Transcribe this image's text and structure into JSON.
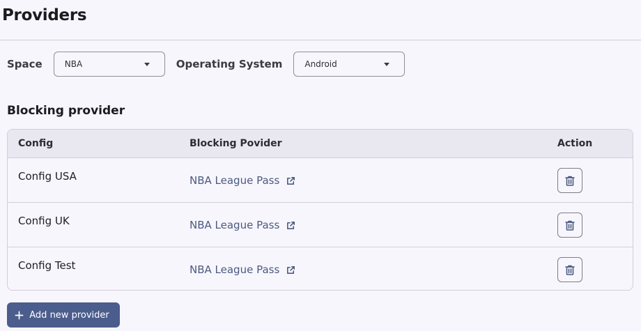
{
  "page": {
    "title": "Providers"
  },
  "filters": {
    "space": {
      "label": "Space",
      "value": "NBA"
    },
    "os": {
      "label": "Operating System",
      "value": "Android"
    }
  },
  "section": {
    "title": "Blocking provider"
  },
  "table": {
    "headers": {
      "config": "Config",
      "provider": "Blocking Povider",
      "action": "Action"
    },
    "rows": [
      {
        "config": "Config USA",
        "provider": "NBA League Pass"
      },
      {
        "config": "Config UK",
        "provider": "NBA League Pass"
      },
      {
        "config": "Config Test",
        "provider": "NBA League Pass"
      }
    ]
  },
  "actions": {
    "add_label": "Add new provider"
  },
  "colors": {
    "accent": "#4b5d8c",
    "link": "#4a5a80",
    "background": "#f8f6fd"
  },
  "icons": {
    "external": "external-link-icon",
    "delete": "trash-icon",
    "add": "plus-icon",
    "dropdown": "caret-down-icon"
  }
}
